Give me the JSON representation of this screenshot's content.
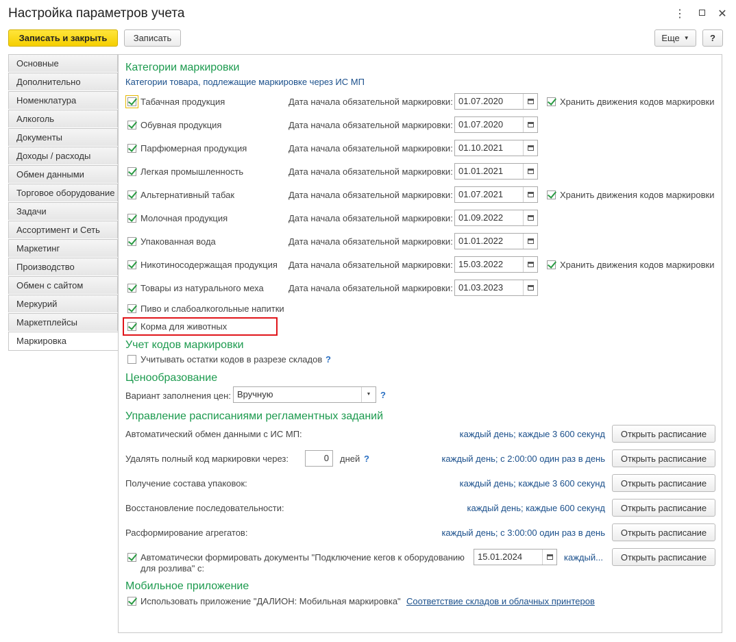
{
  "window": {
    "title": "Настройка параметров учета"
  },
  "toolbar": {
    "save_close": "Записать и закрыть",
    "save": "Записать",
    "more": "Еще",
    "help": "?"
  },
  "tabs": [
    "Основные",
    "Дополнительно",
    "Номенклатура",
    "Алкоголь",
    "Документы",
    "Доходы / расходы",
    "Обмен данными",
    "Торговое оборудование",
    "Задачи",
    "Ассортимент и Сеть",
    "Маркетинг",
    "Производство",
    "Обмен с сайтом",
    "Меркурий",
    "Маркетплейсы",
    "Маркировка"
  ],
  "active_tab": "Маркировка",
  "marking": {
    "heading": "Категории маркировки",
    "subheading": "Категории товара, подлежащие маркировке через ИС МП",
    "date_label": "Дата начала обязательной маркировки:",
    "store_label": "Хранить движения кодов маркировки",
    "items": [
      {
        "label": "Табачная продукция",
        "checked": true,
        "date": "01.07.2020",
        "store": true
      },
      {
        "label": "Обувная продукция",
        "checked": true,
        "date": "01.07.2020"
      },
      {
        "label": "Парфюмерная продукция",
        "checked": true,
        "date": "01.10.2021"
      },
      {
        "label": "Легкая промышленность",
        "checked": true,
        "date": "01.01.2021"
      },
      {
        "label": "Альтернативный табак",
        "checked": true,
        "date": "01.07.2021",
        "store": true
      },
      {
        "label": "Молочная продукция",
        "checked": true,
        "date": "01.09.2022"
      },
      {
        "label": "Упакованная вода",
        "checked": true,
        "date": "01.01.2022"
      },
      {
        "label": "Никотиносодержащая продукция",
        "checked": true,
        "date": "15.03.2022",
        "store": true
      },
      {
        "label": "Товары из натурального меха",
        "checked": true,
        "date": "01.03.2023"
      },
      {
        "label": "Пиво и слабоалкогольные напитки",
        "checked": true
      },
      {
        "label": "Корма для животных",
        "checked": true
      }
    ]
  },
  "codes": {
    "heading": "Учет кодов маркировки",
    "by_warehouse": "Учитывать остатки кодов в разрезе складов",
    "help": "?"
  },
  "pricing": {
    "heading": "Ценообразование",
    "label": "Вариант заполнения цен:",
    "value": "Вручную",
    "help": "?"
  },
  "schedules": {
    "heading": "Управление расписаниями регламентных заданий",
    "open_label": "Открыть расписание",
    "rows": [
      {
        "label": "Автоматический обмен данными с ИС МП:",
        "schedule": "каждый день; каждые 3 600 секунд"
      },
      {
        "label": "Удалять полный код маркировки через:",
        "days_value": "0",
        "days_unit": "дней",
        "help": "?",
        "schedule": "каждый день; с 2:00:00 один раз в день"
      },
      {
        "label": "Получение состава упаковок:",
        "schedule": "каждый день; каждые 3 600 секунд"
      },
      {
        "label": "Восстановление последовательности:",
        "schedule": "каждый день; каждые 600 секунд"
      },
      {
        "label": "Расформирование агрегатов:",
        "schedule": "каждый день; с 3:00:00 один раз в день"
      },
      {
        "label_line1": "Автоматически формировать документы \"Подключение кегов к оборудованию",
        "label_line2": "для розлива\" с:",
        "date": "15.01.2024",
        "schedule": "каждый..."
      }
    ]
  },
  "mobile": {
    "heading": "Мобильное приложение",
    "use_app": "Использовать приложение \"ДАЛИОН: Мобильная маркировка\"",
    "link": "Соответствие складов и облачных принтеров"
  }
}
